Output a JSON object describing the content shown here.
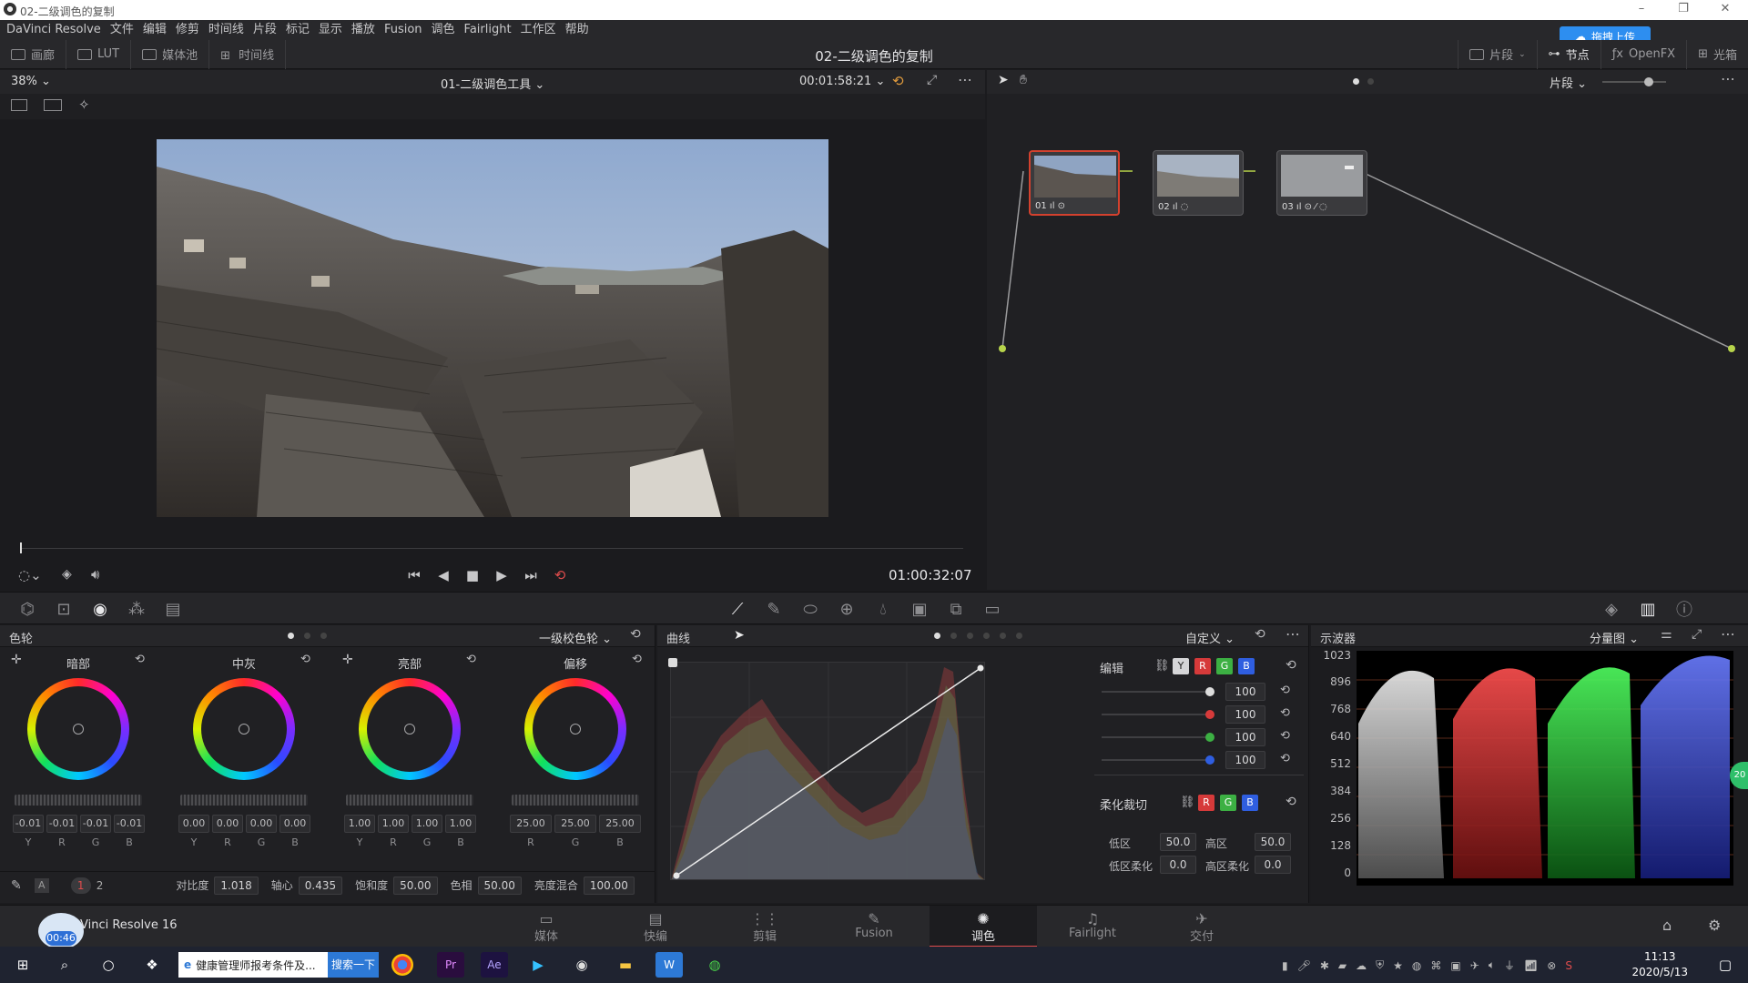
{
  "window": {
    "title": "02-二级调色的复制",
    "controls": [
      "–",
      "❐",
      "✕"
    ]
  },
  "menu": [
    "DaVinci Resolve",
    "文件",
    "编辑",
    "修剪",
    "时间线",
    "片段",
    "标记",
    "显示",
    "播放",
    "Fusion",
    "调色",
    "Fairlight",
    "工作区",
    "帮助"
  ],
  "upload_button": "拖拽上传",
  "toolbar": {
    "left": [
      "画廊",
      "LUT",
      "媒体池",
      "时间线"
    ],
    "project_title": "02-二级调色的复制",
    "right": [
      "片段",
      "节点",
      "OpenFX",
      "光箱"
    ]
  },
  "viewer": {
    "zoom": "38%",
    "clip_name": "01-二级调色工具",
    "source_tc": "00:01:58:21",
    "timecode": "01:00:32:07"
  },
  "node_editor": {
    "mode": "片段",
    "nodes": [
      {
        "label": "01",
        "selected": true
      },
      {
        "label": "02",
        "selected": false
      },
      {
        "label": "03",
        "selected": false
      }
    ]
  },
  "wheels": {
    "title": "色轮",
    "mode": "一级校色轮",
    "items": [
      {
        "name": "暗部",
        "values": [
          "-0.01",
          "-0.01",
          "-0.01",
          "-0.01"
        ],
        "labels": [
          "Y",
          "R",
          "G",
          "B"
        ]
      },
      {
        "name": "中灰",
        "values": [
          "0.00",
          "0.00",
          "0.00",
          "0.00"
        ],
        "labels": [
          "Y",
          "R",
          "G",
          "B"
        ]
      },
      {
        "name": "亮部",
        "values": [
          "1.00",
          "1.00",
          "1.00",
          "1.00"
        ],
        "labels": [
          "Y",
          "R",
          "G",
          "B"
        ]
      },
      {
        "name": "偏移",
        "values": [
          "25.00",
          "25.00",
          "25.00"
        ],
        "labels": [
          "R",
          "G",
          "B"
        ]
      }
    ],
    "footer": {
      "page_1": "1",
      "page_2": "2",
      "contrast_label": "对比度",
      "contrast": "1.018",
      "pivot_label": "轴心",
      "pivot": "0.435",
      "sat_label": "饱和度",
      "sat": "50.00",
      "hue_label": "色相",
      "hue": "50.00",
      "lummix_label": "亮度混合",
      "lummix": "100.00"
    }
  },
  "curves": {
    "title": "曲线",
    "mode": "自定义",
    "edit_label": "编辑",
    "channels": [
      "Y",
      "R",
      "G",
      "B"
    ],
    "intensity": [
      "100",
      "100",
      "100",
      "100"
    ],
    "soft_clip_label": "柔化裁切",
    "soft_channels": [
      "R",
      "G",
      "B"
    ],
    "low_label": "低区",
    "low": "50.0",
    "high_label": "高区",
    "high": "50.0",
    "low_soft_label": "低区柔化",
    "low_soft": "0.0",
    "high_soft_label": "高区柔化",
    "high_soft": "0.0"
  },
  "scope": {
    "title": "示波器",
    "mode": "分量图",
    "y_ticks": [
      "1023",
      "896",
      "768",
      "640",
      "512",
      "384",
      "256",
      "128",
      "0"
    ],
    "badge": "20"
  },
  "footer_app": "Vinci Resolve 16",
  "badge_time": "00:46",
  "pages": [
    {
      "label": "媒体",
      "icon": "▭"
    },
    {
      "label": "快编",
      "icon": "▤"
    },
    {
      "label": "剪辑",
      "icon": "⋮⋮"
    },
    {
      "label": "Fusion",
      "icon": "✎"
    },
    {
      "label": "调色",
      "icon": "✺"
    },
    {
      "label": "Fairlight",
      "icon": "♫"
    },
    {
      "label": "交付",
      "icon": "✈"
    }
  ],
  "taskbar": {
    "search_text": "健康管理师报考条件及...",
    "search_button": "搜索一下",
    "time": "11:13",
    "date": "2020/5/13"
  },
  "colors": {
    "accent_red": "#e04c4c",
    "blue": "#2d8ef0",
    "bg": "#1b1b1e"
  }
}
